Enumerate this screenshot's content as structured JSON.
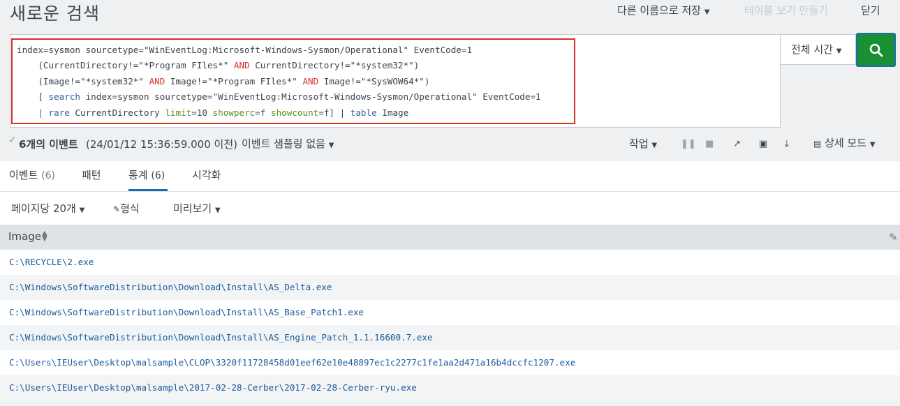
{
  "header": {
    "title": "새로운 검색",
    "save_as": "다른 이름으로 저장",
    "make_table": "테이블 보기 만들기",
    "close": "닫기"
  },
  "search": {
    "line1_a": "index=sysmon sourcetype=\"WinEventLog:Microsoft-Windows-Sysmon/Operational\" EventCode=1",
    "line2_a": "    (CurrentDirectory!=\"*Program FIles*\" ",
    "line2_b": "AND",
    "line2_c": " CurrentDirectory!=\"*system32*\")",
    "line3_a": "    (Image!=\"*system32*\" ",
    "line3_b": "AND",
    "line3_c": " Image!=\"*Program FIles*\" ",
    "line3_d": "AND",
    "line3_e": " Image!=\"*SysWOW64*\")",
    "line4_a": "    [ ",
    "line4_b": "search",
    "line4_c": " index=sysmon sourcetype=\"WinEventLog:Microsoft-Windows-Sysmon/Operational\" EventCode=1",
    "line5_a": "    | ",
    "line5_b": "rare",
    "line5_c": " CurrentDirectory ",
    "line5_d": "limit",
    "line5_e": "=10 ",
    "line5_f": "showperc",
    "line5_g": "=f ",
    "line5_h": "showcount",
    "line5_i": "=f] | ",
    "line5_j": "table",
    "line5_k": " Image",
    "time_range": "전체 시간"
  },
  "status": {
    "event_count": "6개의 이벤트",
    "event_time": "(24/01/12 15:36:59.000 이전)",
    "sampling": "이벤트 샘플링 없음",
    "job": "작업",
    "detail_mode": "상세 모드"
  },
  "tabs": [
    {
      "label": "이벤트",
      "count": "(6)"
    },
    {
      "label": "패턴"
    },
    {
      "label": "통계",
      "count": "(6)"
    },
    {
      "label": "시각화"
    }
  ],
  "options": {
    "per_page": "페이지당 20개",
    "format": "형식",
    "preview": "미리보기"
  },
  "table": {
    "column": "Image",
    "rows": [
      "C:\\RECYCLE\\2.exe",
      "C:\\Windows\\SoftwareDistribution\\Download\\Install\\AS_Delta.exe",
      "C:\\Windows\\SoftwareDistribution\\Download\\Install\\AS_Base_Patch1.exe",
      "C:\\Windows\\SoftwareDistribution\\Download\\Install\\AS_Engine_Patch_1.1.16600.7.exe",
      "C:\\Users\\IEUser\\Desktop\\malsample\\CLOP\\3320f11728458d01eef62e10e48897ec1c2277c1fe1aa2d471a16b4dccfc1207.exe",
      "C:\\Users\\IEUser\\Desktop\\malsample\\2017-02-28-Cerber\\2017-02-28-Cerber-ryu.exe"
    ]
  },
  "colors": {
    "accent": "#1a6ab5",
    "search_button": "#1a9035",
    "highlight_border": "#d6302b"
  }
}
